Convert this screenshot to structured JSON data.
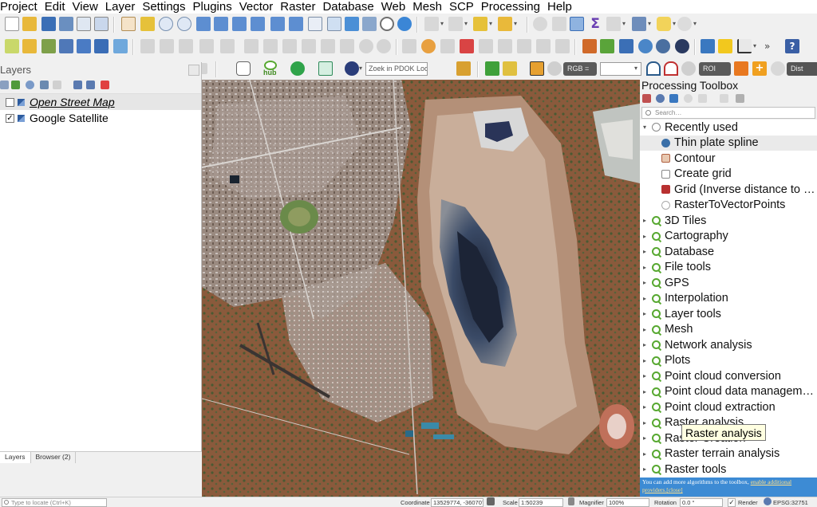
{
  "menubar": {
    "items": [
      "Project",
      "Edit",
      "View",
      "Layer",
      "Settings",
      "Plugins",
      "Vector",
      "Raster",
      "Database",
      "Web",
      "Mesh",
      "SCP",
      "Processing",
      "Help"
    ]
  },
  "toolbar3": {
    "hub_label": "hub",
    "pdok_placeholder": "Zoek in PDOK Loc…",
    "rgb_label": "RGB =",
    "rgb_value": "",
    "roi_label": "ROI",
    "dist_label": "Dist"
  },
  "layers_panel": {
    "title": "Layers",
    "layers": [
      {
        "name": "Open Street Map",
        "checked": false,
        "checkmark": ""
      },
      {
        "name": "Google Satellite",
        "checked": true,
        "checkmark": "✓"
      }
    ],
    "tabs": [
      "Layers",
      "Browser (2)"
    ]
  },
  "toolbox": {
    "title": "Processing Toolbox",
    "search_placeholder": "Search…",
    "recently_used": {
      "label": "Recently used",
      "items": [
        "Thin plate spline",
        "Contour",
        "Create grid",
        "Grid (Inverse distance to …",
        "RasterToVectorPoints"
      ]
    },
    "groups": [
      "3D Tiles",
      "Cartography",
      "Database",
      "File tools",
      "GPS",
      "Interpolation",
      "Layer tools",
      "Mesh",
      "Network analysis",
      "Plots",
      "Point cloud conversion",
      "Point cloud data managem…",
      "Point cloud extraction",
      "Raster analysis",
      "Raster Creation",
      "Raster terrain analysis",
      "Raster tools"
    ],
    "tooltip": "Raster analysis",
    "info_text": "You can add more algorithms to the toolbox,",
    "info_link1": "enable additional",
    "info_link2": "providers.",
    "info_close": "[close]"
  },
  "statusbar": {
    "locator_placeholder": "Type to locate (Ctrl+K)",
    "coordinate_label": "Coordinate",
    "coordinate_value": "13529774, -3607074",
    "scale_label": "Scale",
    "scale_value": "1:50239",
    "magnifier_label": "Magnifier",
    "magnifier_value": "100%",
    "rotation_label": "Rotation",
    "rotation_value": "0.0 °",
    "render_label": "Render",
    "crs_label": "EPSG:32751"
  },
  "colors": {
    "accent": "#3d8bd4",
    "qgis_green": "#57a830",
    "map_ground": "#8c6a50",
    "pit_water": "#1c2436"
  }
}
